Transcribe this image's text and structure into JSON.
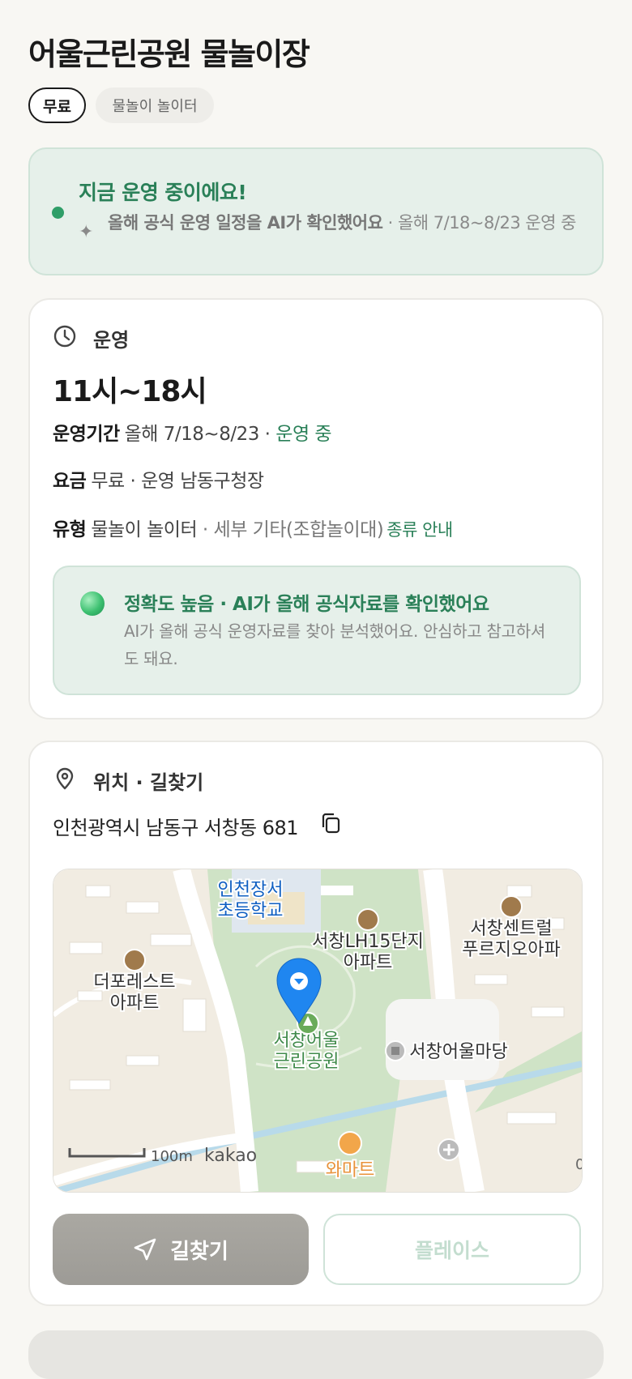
{
  "header": {
    "title": "어울근린공원 물놀이장",
    "chips": [
      "무료",
      "물놀이 놀이터"
    ]
  },
  "status": {
    "title": "지금 운영 중이에요!",
    "desc_strong": "올해 공식 운영 일정을 AI가 확인했어요",
    "desc_rest": " · 올해 7/18~8/23 운영 중"
  },
  "operation": {
    "section_label": "운영",
    "hours": "11시~18시",
    "period_label": "운영기간",
    "period_value": "올해 7/18~8/23 · ",
    "period_status": "운영 중",
    "fee_label": "요금",
    "fee_value": "무료 · 운영 남동구청장",
    "type_label": "유형",
    "type_value": "물놀이 놀이터",
    "type_detail": " · 세부 기타(조합놀이대)",
    "type_link": "종류 안내",
    "accuracy_title": "정확도 높음 · AI가 올해 공식자료를 확인했어요",
    "accuracy_desc": "AI가 올해 공식 운영자료를 찾아 분석했어요. 안심하고 참고하셔도 돼요."
  },
  "location": {
    "section_label": "위치 · 길찾기",
    "address": "인천광역시 남동구 서창동 681",
    "map": {
      "labels": {
        "school": [
          "인천장서",
          "초등학교"
        ],
        "apt_lh": [
          "서창LH15단지",
          "아파트"
        ],
        "apt_center": [
          "서창센트럴",
          "푸르지오아파"
        ],
        "apt_forest": [
          "더포레스트",
          "아파트"
        ],
        "park": [
          "서창어울",
          "근린공원"
        ],
        "plaza": "서창어울마당",
        "mart": "와마트",
        "scale": "100m",
        "brand": "kakao",
        "edge": "0"
      }
    },
    "route_button": "길찾기",
    "place_button": "플레이스"
  },
  "colors": {
    "accent_green": "#2a8058",
    "status_bg": "#e6f0ea",
    "marker_blue": "#1f86f0"
  }
}
